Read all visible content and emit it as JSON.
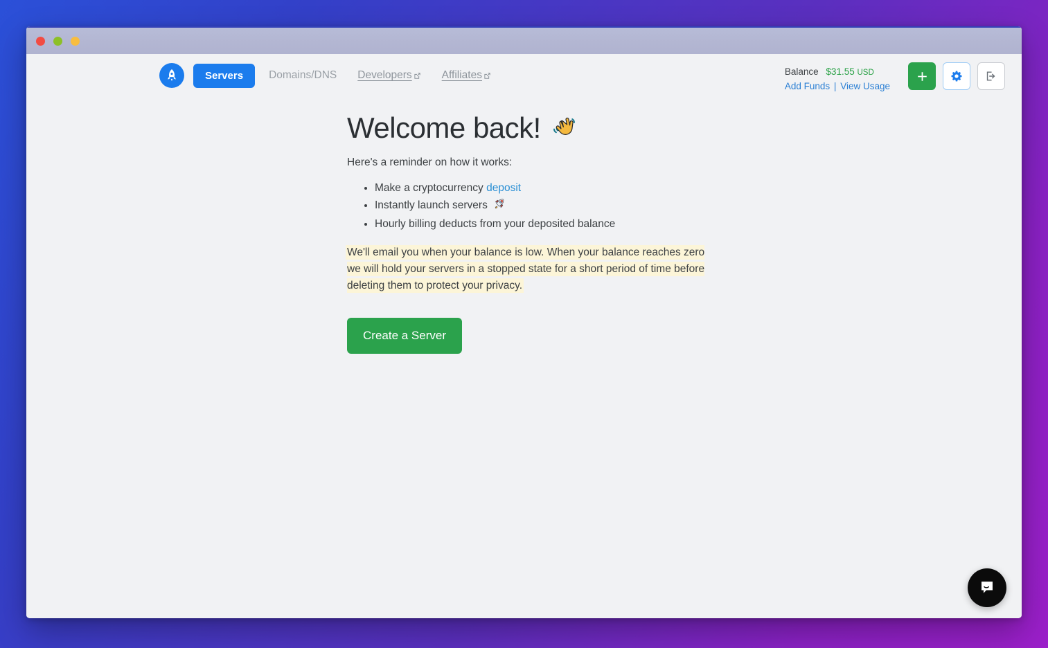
{
  "window": {
    "traffic_lights": [
      "red",
      "green",
      "yellow"
    ],
    "title": ""
  },
  "navbar": {
    "logo_icon": "rocket-logo-icon",
    "items": [
      {
        "label": "Servers",
        "state": "active",
        "external": false
      },
      {
        "label": "Domains/DNS",
        "state": "inactive",
        "external": false
      },
      {
        "label": "Developers",
        "state": "link",
        "external": true
      },
      {
        "label": "Affiliates",
        "state": "link",
        "external": true
      }
    ],
    "account": {
      "balance_label": "Balance",
      "balance_amount": "$31.55",
      "balance_currency": "USD",
      "add_funds_label": "Add Funds",
      "separator": "|",
      "view_usage_label": "View Usage",
      "buttons": [
        {
          "name": "add-button",
          "icon": "plus-icon",
          "title": "Add"
        },
        {
          "name": "settings-button",
          "icon": "gear-icon",
          "title": "Settings"
        },
        {
          "name": "logout-button",
          "icon": "logout-icon",
          "title": "Log out"
        }
      ]
    }
  },
  "main": {
    "headline": "Welcome back!",
    "headline_emoji": "waving-hand-emoji",
    "subhead": "Here's a reminder on how it works:",
    "reminders": [
      {
        "text_before": "Make a cryptocurrency ",
        "link": "deposit",
        "text_after": "",
        "emoji": ""
      },
      {
        "text_before": "Instantly launch servers",
        "link": "",
        "text_after": "",
        "emoji": "rocket-emoji"
      },
      {
        "text_before": "Hourly billing deducts from your deposited balance",
        "link": "",
        "text_after": "",
        "emoji": ""
      }
    ],
    "notice": "We'll email you when your balance is low. When your balance reaches zero we will hold your servers in a stopped state for a short period of time before deleting them to protect your privacy.",
    "cta_label": "Create a Server"
  },
  "chat": {
    "icon": "chat-bubble-icon",
    "label": "Open chat"
  },
  "colors": {
    "accent_blue": "#1b7ced",
    "link_blue": "#2a7fd4",
    "success_green": "#2ba24c",
    "balance_green": "#26a043",
    "highlight_yellow": "#fcf5d8",
    "window_bg": "#f1f2f4",
    "titlebar": "#b3b6d2"
  }
}
